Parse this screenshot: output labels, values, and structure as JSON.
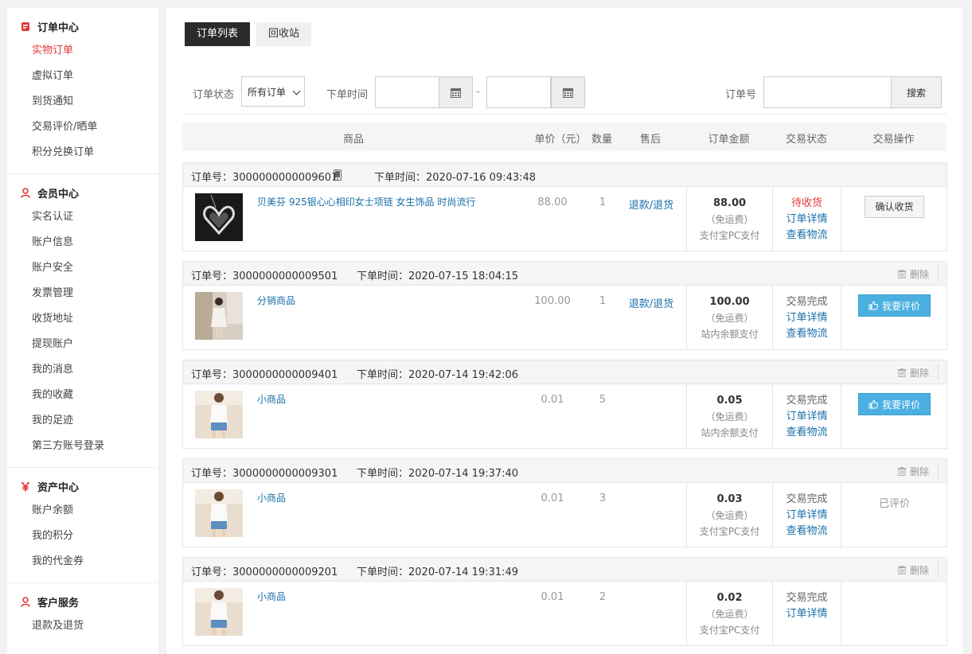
{
  "sidebar": {
    "groups": [
      {
        "title": "订单中心",
        "icon": "order-icon",
        "items": [
          "实物订单",
          "虚拟订单",
          "到货通知",
          "交易评价/晒单",
          "积分兑换订单"
        ],
        "active": 0
      },
      {
        "title": "会员中心",
        "icon": "user-icon",
        "items": [
          "实名认证",
          "账户信息",
          "账户安全",
          "发票管理",
          "收货地址",
          "提现账户",
          "我的消息",
          "我的收藏",
          "我的足迹",
          "第三方账号登录"
        ]
      },
      {
        "title": "资产中心",
        "icon": "yen-icon",
        "items": [
          "账户余额",
          "我的积分",
          "我的代金券"
        ]
      },
      {
        "title": "客户服务",
        "icon": "service-icon",
        "items": [
          "退款及退货"
        ]
      }
    ],
    "accent_color": "#e4393c"
  },
  "tabs": {
    "list": "订单列表",
    "recycle": "回收站"
  },
  "filter": {
    "status_label": "订单状态",
    "status_value": "所有订单",
    "time_label": "下单时间",
    "dash": "–",
    "order_no_label": "订单号",
    "search_button": "搜索"
  },
  "table_head": {
    "goods": "商品",
    "price": "单价（元）",
    "qty": "数量",
    "after_sale": "售后",
    "amount": "订单金额",
    "status": "交易状态",
    "operation": "交易操作"
  },
  "orders": [
    {
      "no_label": "订单号：3000000000009601",
      "time_label": "下单时间：2020-07-16 09:43:48",
      "name": "贝美芬 925银心心相印女士项链 女生饰品 时尚流行",
      "price": "88.00",
      "qty": "1",
      "after_sale": "退款/退货",
      "amount": "88.00",
      "freight": "（免运费）",
      "pay": "支付宝PC支付",
      "status": "待收货",
      "detail": "订单详情",
      "logistics": "查看物流",
      "action": "确认收货",
      "thumb": "necklace"
    },
    {
      "no_label": "订单号：3000000000009501",
      "time_label": "下单时间：2020-07-15 18:04:15",
      "name": "分销商品",
      "price": "100.00",
      "qty": "1",
      "after_sale": "退款/退货",
      "amount": "100.00",
      "freight": "（免运费）",
      "pay": "站内余额支付",
      "status": "交易完成",
      "detail": "订单详情",
      "logistics": "查看物流",
      "action": "我要评价",
      "delete": "删除",
      "thumb": "dress"
    },
    {
      "no_label": "订单号：3000000000009401",
      "time_label": "下单时间：2020-07-14 19:42:06",
      "name": "小商品",
      "price": "0.01",
      "qty": "5",
      "amount": "0.05",
      "freight": "（免运费）",
      "pay": "站内余额支付",
      "status": "交易完成",
      "detail": "订单详情",
      "logistics": "查看物流",
      "action": "我要评价",
      "delete": "删除",
      "thumb": "shirt"
    },
    {
      "no_label": "订单号：3000000000009301",
      "time_label": "下单时间：2020-07-14 19:37:40",
      "name": "小商品",
      "price": "0.01",
      "qty": "3",
      "amount": "0.03",
      "freight": "（免运费）",
      "pay": "支付宝PC支付",
      "status": "交易完成",
      "detail": "订单详情",
      "logistics": "查看物流",
      "reviewed": "已评价",
      "delete": "删除",
      "thumb": "shirt"
    },
    {
      "no_label": "订单号：3000000000009201",
      "time_label": "下单时间：2020-07-14 19:31:49",
      "name": "小商品",
      "price": "0.01",
      "qty": "2",
      "amount": "0.02",
      "freight": "（免运费）",
      "pay": "支付宝PC支付",
      "status": "交易完成",
      "detail": "订单详情",
      "delete": "删除",
      "thumb": "shirt"
    }
  ]
}
